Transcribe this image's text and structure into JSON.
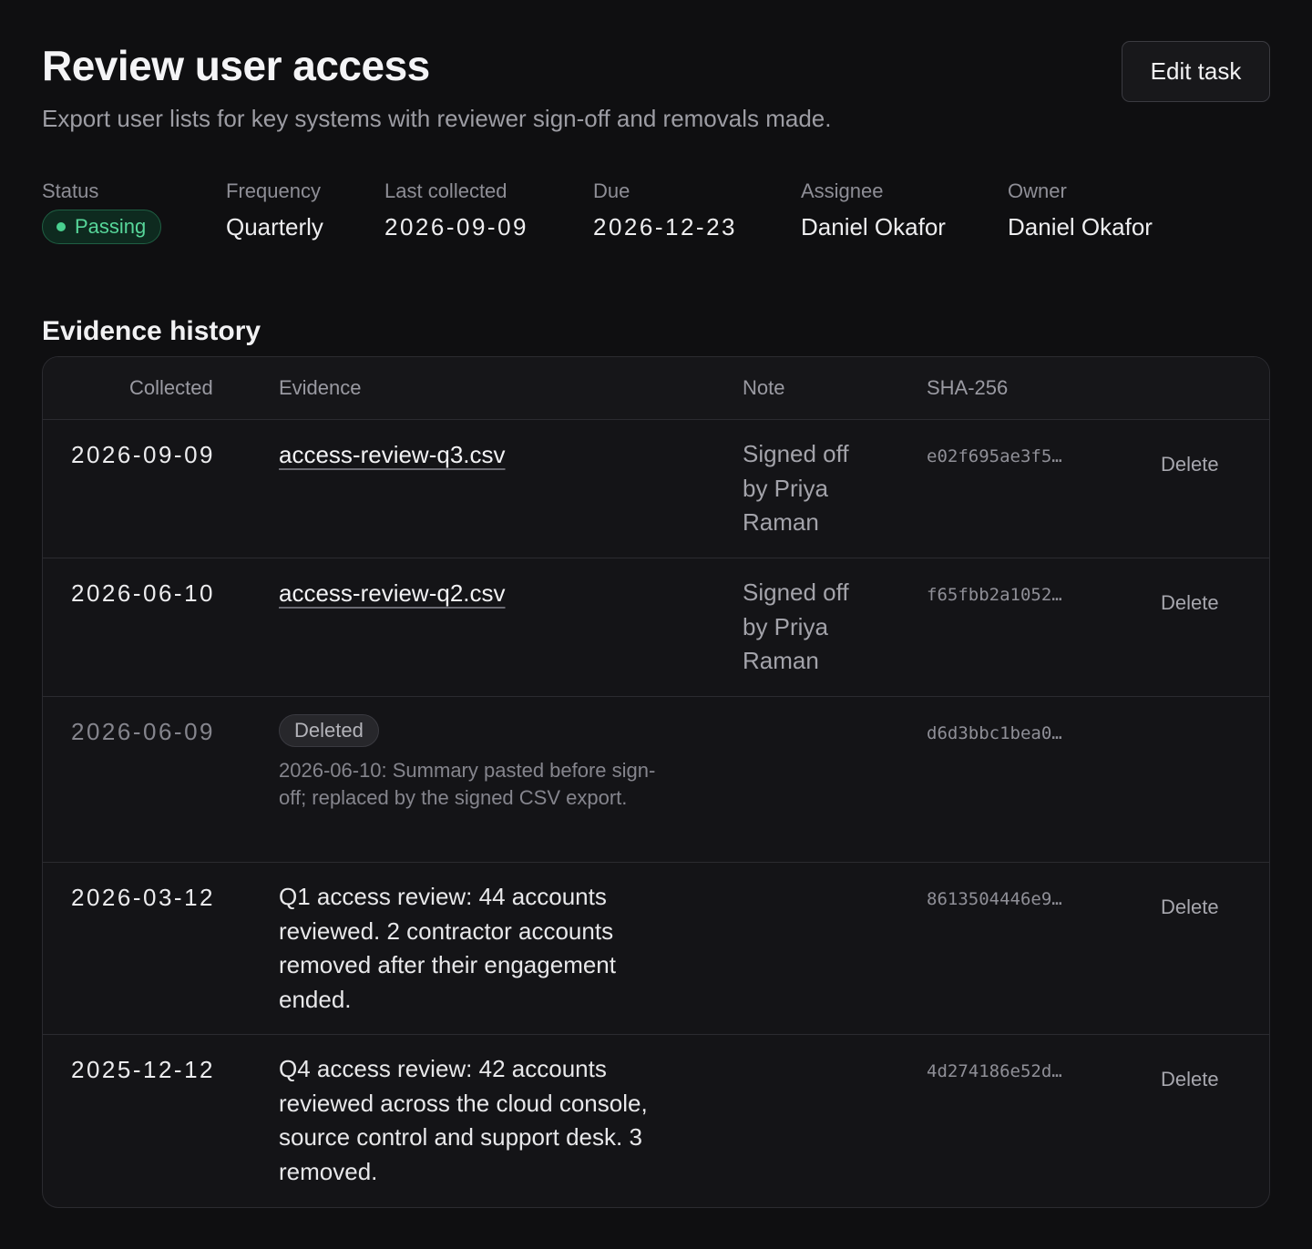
{
  "header": {
    "title": "Review user access",
    "subtitle": "Export user lists for key systems with reviewer sign-off and removals made.",
    "edit_label": "Edit task"
  },
  "meta": {
    "status_label": "Status",
    "status_value": "Passing",
    "frequency_label": "Frequency",
    "frequency_value": "Quarterly",
    "last_collected_label": "Last collected",
    "last_collected_value": "2026-09-09",
    "due_label": "Due",
    "due_value": "2026-12-23",
    "assignee_label": "Assignee",
    "assignee_value": "Daniel Okafor",
    "owner_label": "Owner",
    "owner_value": "Daniel Okafor"
  },
  "evidence": {
    "section_title": "Evidence history",
    "columns": {
      "collected": "Collected",
      "evidence": "Evidence",
      "note": "Note",
      "sha": "SHA-256"
    },
    "rows": [
      {
        "collected": "2026-09-09",
        "evidence": "access-review-q3.csv",
        "note": "Signed off by Priya Raman",
        "sha": "e02f695ae3f5…",
        "action": "Delete"
      },
      {
        "collected": "2026-06-10",
        "evidence": "access-review-q2.csv",
        "note": "Signed off by Priya Raman",
        "sha": "f65fbb2a1052…",
        "action": "Delete"
      },
      {
        "collected": "2026-06-09",
        "deleted_badge": "Deleted",
        "deleted_note": "2026-06-10: Summary pasted before sign-off; replaced by the signed CSV export.",
        "sha": "d6d3bbc1bea0…"
      },
      {
        "collected": "2026-03-12",
        "evidence": "Q1 access review: 44 accounts reviewed. 2 contractor accounts removed after their engagement ended.",
        "sha": "8613504446e9…",
        "action": "Delete"
      },
      {
        "collected": "2025-12-12",
        "evidence": "Q4 access review: 42 accounts reviewed across the cloud console, source control and support desk. 3 removed.",
        "sha": "4d274186e52d…",
        "action": "Delete"
      }
    ]
  },
  "colors": {
    "background": "#0f0f11",
    "accent_pass": "#57d69a",
    "border": "#2b2b30"
  }
}
